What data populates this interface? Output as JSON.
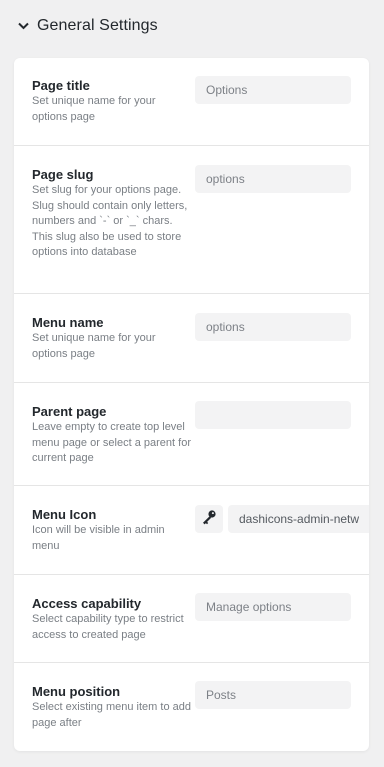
{
  "section": {
    "title": "General Settings",
    "toggle_icon": "chevron-down-icon"
  },
  "rows": [
    {
      "label": "Page title",
      "desc": "Set unique name for your options page",
      "value": "Options"
    },
    {
      "label": "Page slug",
      "desc": "Set slug for your options page. Slug should contain only letters, numbers and `-` or `_` chars. This slug also be used to store options into database",
      "value": "options"
    },
    {
      "label": "Menu name",
      "desc": "Set unique name for your options page",
      "value": "options"
    },
    {
      "label": "Parent page",
      "desc": "Leave empty to create top level menu page or select a parent for current page",
      "value": ""
    },
    {
      "label": "Menu Icon",
      "desc": "Icon will be visible in admin menu",
      "value": "dashicons-admin-netw",
      "icon": "key-icon"
    },
    {
      "label": "Access capability",
      "desc": "Select capability type to restrict access to created page",
      "value": "Manage options"
    },
    {
      "label": "Menu position",
      "desc": "Select existing menu item to add page after",
      "value": "Posts"
    }
  ]
}
